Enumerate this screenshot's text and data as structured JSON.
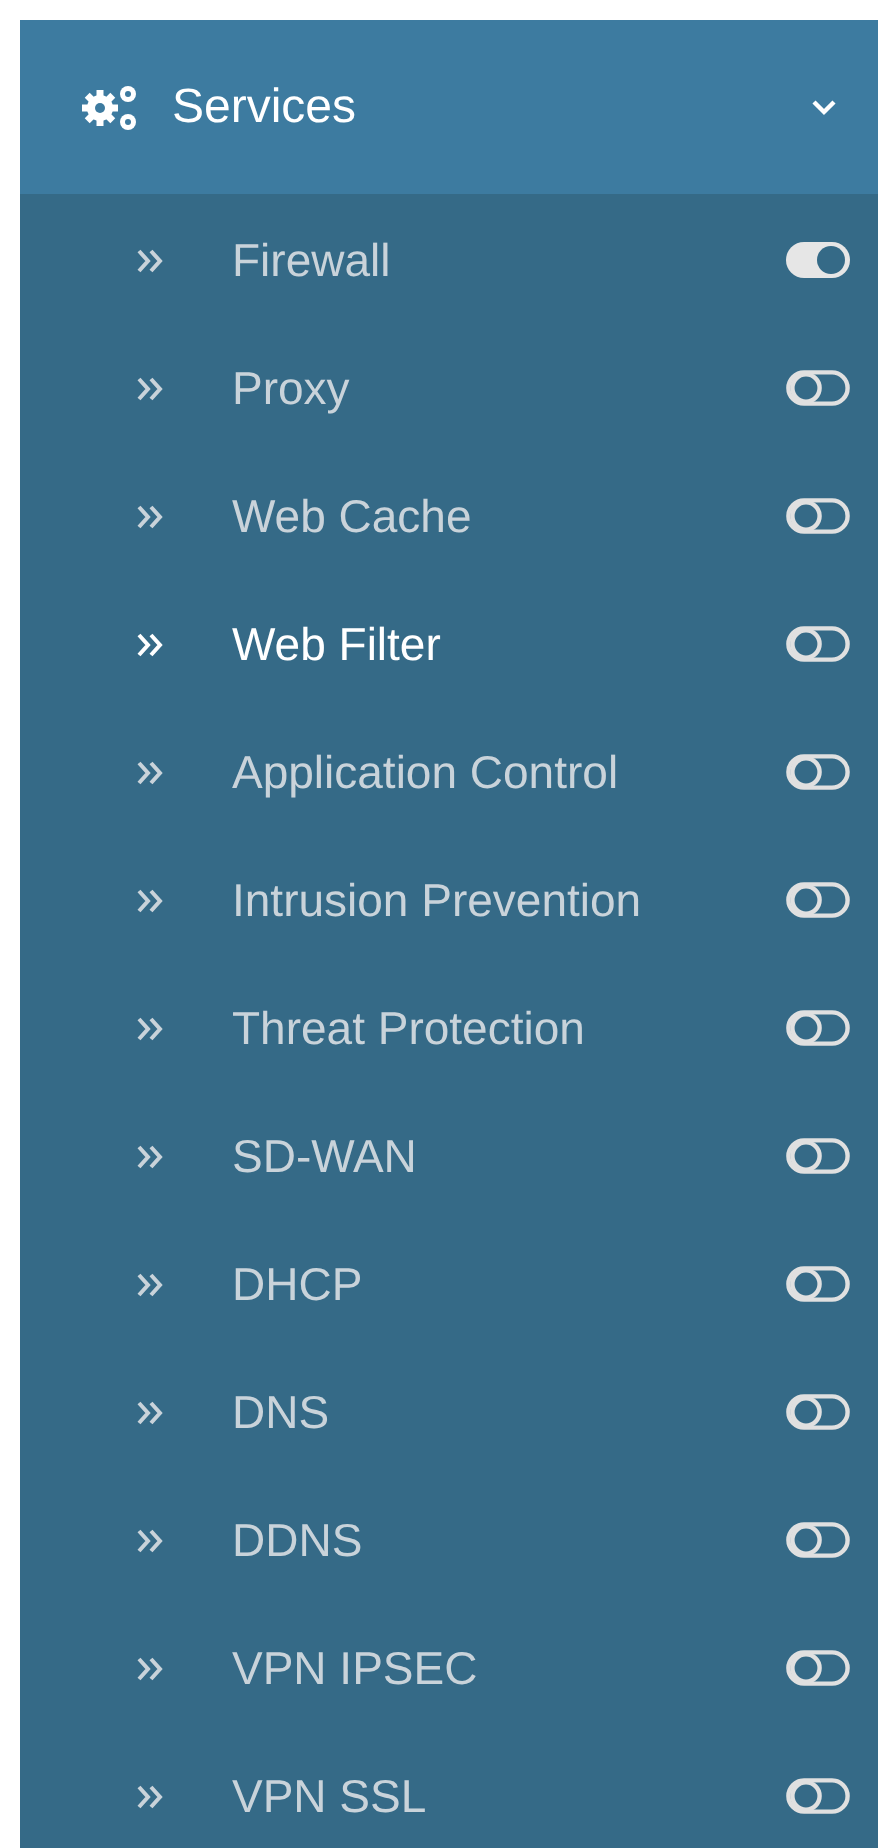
{
  "menu": {
    "title": "Services",
    "expanded": true,
    "items": [
      {
        "label": "Firewall",
        "selected": false,
        "on": true
      },
      {
        "label": "Proxy",
        "selected": false,
        "on": false
      },
      {
        "label": "Web Cache",
        "selected": false,
        "on": false
      },
      {
        "label": "Web Filter",
        "selected": true,
        "on": false
      },
      {
        "label": "Application Control",
        "selected": false,
        "on": false
      },
      {
        "label": "Intrusion Prevention",
        "selected": false,
        "on": false
      },
      {
        "label": "Threat Protection",
        "selected": false,
        "on": false
      },
      {
        "label": "SD-WAN",
        "selected": false,
        "on": false
      },
      {
        "label": "DHCP",
        "selected": false,
        "on": false
      },
      {
        "label": "DNS",
        "selected": false,
        "on": false
      },
      {
        "label": "DDNS",
        "selected": false,
        "on": false
      },
      {
        "label": "VPN IPSEC",
        "selected": false,
        "on": false
      },
      {
        "label": "VPN SSL",
        "selected": false,
        "on": false
      }
    ]
  }
}
